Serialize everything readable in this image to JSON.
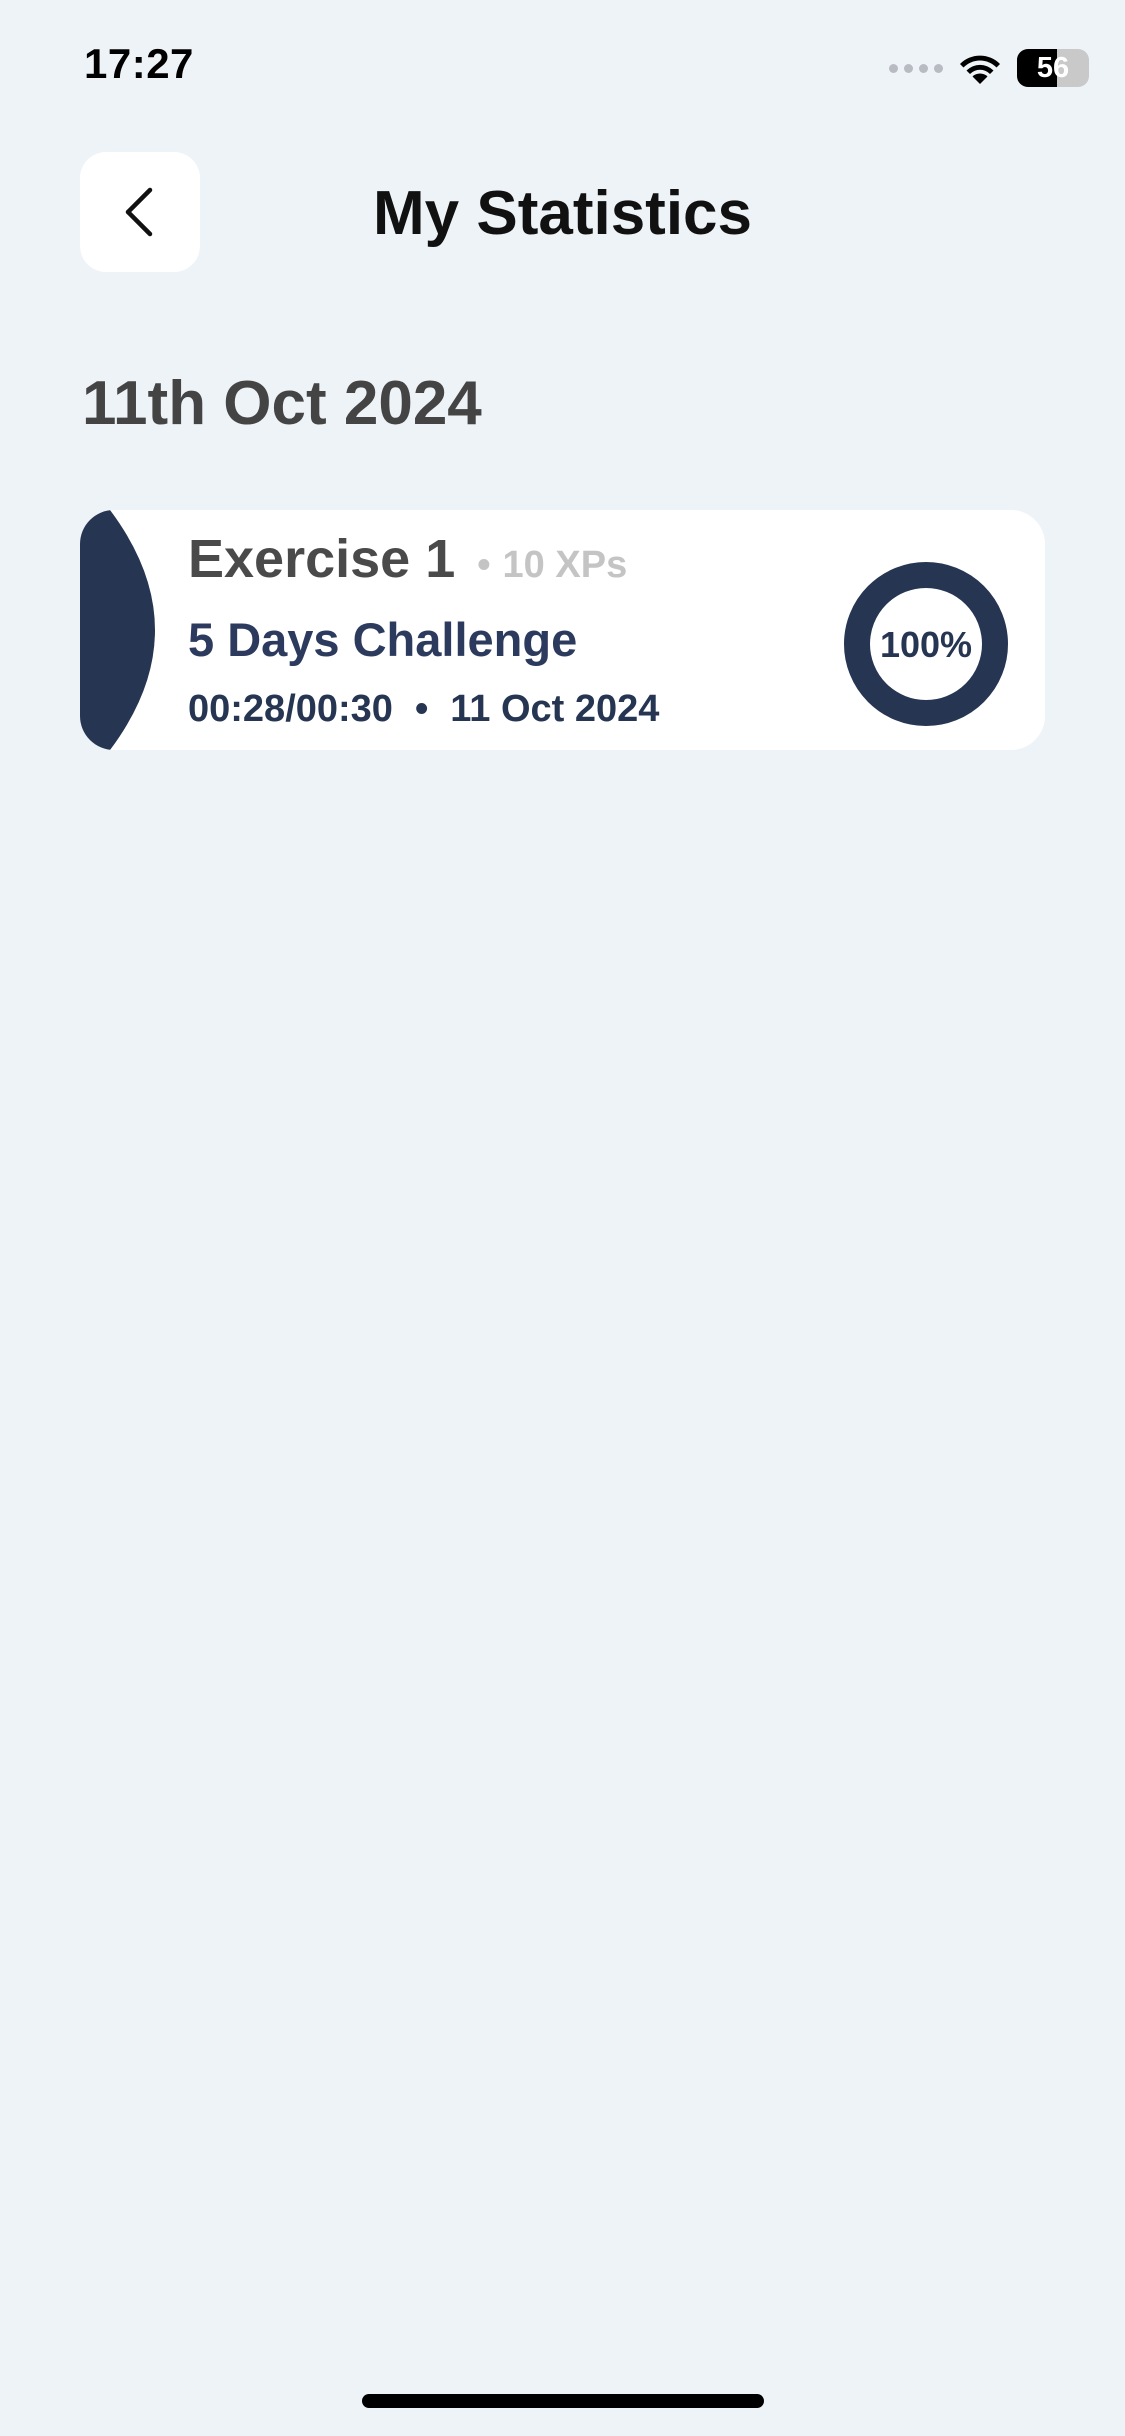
{
  "status_bar": {
    "time": "17:27",
    "battery_level": "56",
    "battery_fraction": 0.56,
    "icons": [
      "cellular-signal-icon",
      "wifi-icon",
      "battery-icon"
    ]
  },
  "header": {
    "title": "My Statistics",
    "back_icon": "chevron-left-icon"
  },
  "sections": [
    {
      "date_label": "11th Oct 2024",
      "exercises": [
        {
          "title": "Exercise 1",
          "separator": "•",
          "xp": "10 XPs",
          "subtitle": "5 Days Challenge",
          "duration": "00:28/00:30",
          "meta_separator": "•",
          "date": "11 Oct 2024",
          "progress_label": "100%",
          "progress_value": 1.0
        }
      ]
    }
  ],
  "colors": {
    "background": "#eef3f8",
    "card": "#ffffff",
    "accent": "#263552",
    "title_text": "#4a4a4a",
    "muted_text": "#c4c4c4"
  }
}
